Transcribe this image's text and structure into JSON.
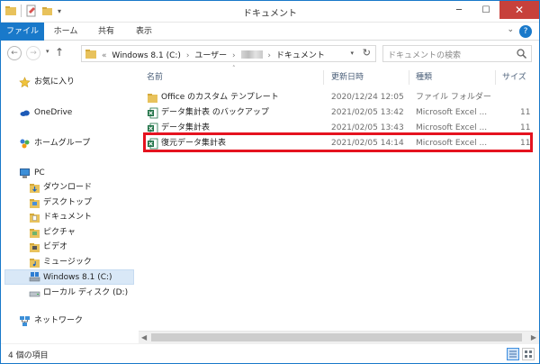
{
  "window": {
    "title": "ドキュメント",
    "controls": {
      "minimize": "─",
      "maximize": "☐",
      "close": "✕"
    }
  },
  "quick_access": {
    "dropdown": "▾"
  },
  "ribbon": {
    "tabs": [
      {
        "label": "ファイル",
        "active": true
      },
      {
        "label": "ホーム"
      },
      {
        "label": "共有"
      },
      {
        "label": "表示"
      }
    ],
    "collapse": "⌄",
    "help": "?"
  },
  "address": {
    "prefix": "«",
    "crumbs": [
      "Windows 8.1 (C:)",
      "ユーザー",
      "ドキュメント"
    ],
    "separator": "›",
    "dropdown": "▾",
    "refresh": "↻"
  },
  "search": {
    "placeholder": "ドキュメントの検索"
  },
  "nav": {
    "back": "←",
    "forward": "→",
    "history": "▾",
    "up": "↑",
    "items": [
      {
        "label": "お気に入り",
        "icon": "star-icon"
      },
      {
        "label": "OneDrive",
        "icon": "cloud-icon"
      },
      {
        "label": "ホームグループ",
        "icon": "homegroup-icon"
      },
      {
        "label": "PC",
        "icon": "computer-icon"
      },
      {
        "label": "ダウンロード",
        "icon": "folder-icon"
      },
      {
        "label": "デスクトップ",
        "icon": "folder-icon"
      },
      {
        "label": "ドキュメント",
        "icon": "folder-icon"
      },
      {
        "label": "ピクチャ",
        "icon": "folder-icon"
      },
      {
        "label": "ビデオ",
        "icon": "folder-icon"
      },
      {
        "label": "ミュージック",
        "icon": "folder-icon"
      },
      {
        "label": "Windows 8.1 (C:)",
        "icon": "drive-icon",
        "selected": true
      },
      {
        "label": "ローカル ディスク (D:)",
        "icon": "drive-icon"
      },
      {
        "label": "ネットワーク",
        "icon": "network-icon"
      }
    ]
  },
  "columns": {
    "name": "名前",
    "date": "更新日時",
    "type": "種類",
    "size": "サイズ",
    "sort_indicator": "˄"
  },
  "files": [
    {
      "name": "Office のカスタム テンプレート",
      "date": "2020/12/24 12:05",
      "type": "ファイル フォルダー",
      "size": "",
      "icon": "folder-icon"
    },
    {
      "name": "データ集計表 のバックアップ",
      "date": "2021/02/05 13:42",
      "type": "Microsoft Excel ...",
      "size": "11",
      "icon": "excel-icon"
    },
    {
      "name": "データ集計表",
      "date": "2021/02/05 13:43",
      "type": "Microsoft Excel ...",
      "size": "11",
      "icon": "excel-icon"
    },
    {
      "name": "復元データ集計表",
      "date": "2021/02/05 14:14",
      "type": "Microsoft Excel ...",
      "size": "11",
      "icon": "excel-icon",
      "highlighted": true
    }
  ],
  "scrollbar": {
    "left": "◀",
    "right": "▶"
  },
  "status": {
    "item_count": "4 個の項目"
  },
  "colors": {
    "accent": "#1979ca",
    "highlight": "#e5131f",
    "selection": "#d9e8f7",
    "folder": "#e8c25c",
    "excel": "#1f7246"
  }
}
